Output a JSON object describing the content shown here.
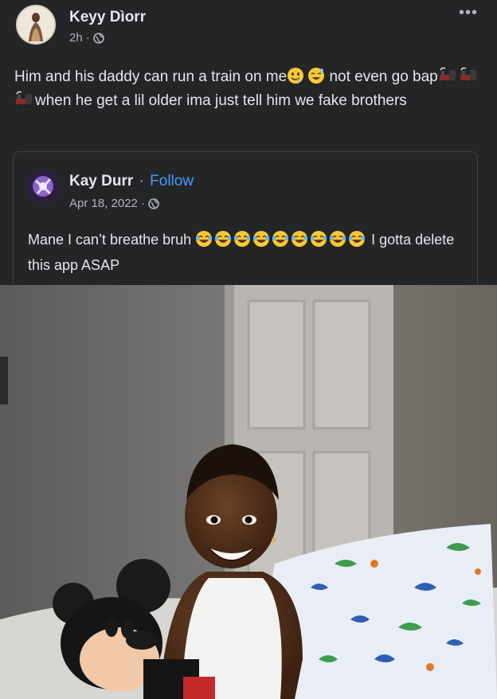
{
  "post": {
    "author": "Keyy Dìorr",
    "time": "2h",
    "separator": "·",
    "more_label": "•••",
    "text_part1": "Him and his daddy can run a train on me",
    "text_part2": " not even go bap",
    "text_part3": "when he get a lil older ima just tell him we fake brothers",
    "emojis": [
      "drooling-face-emoji",
      "sweat-smile-emoji",
      "locomotive-emoji",
      "locomotive-emoji",
      "locomotive-emoji"
    ]
  },
  "shared_post": {
    "author": "Kay Durr",
    "separator": "·",
    "follow_label": "Follow",
    "date": "Apr 18, 2022",
    "text_part1": "Mane I can’t breathe bruh ",
    "text_part2": " I gotta delete this app ASAP",
    "laugh_emoji_count": 9,
    "photo_icon": "child-with-plush-toy-photo"
  },
  "colors": {
    "background": "#242526",
    "text": "#e4e6eb",
    "secondary_text": "#b0b3b8",
    "link": "#4599ff"
  }
}
